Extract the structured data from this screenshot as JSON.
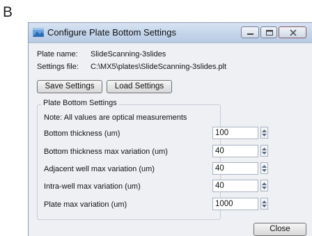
{
  "panel_letter": "B",
  "window": {
    "title": "Configure Plate Bottom Settings",
    "controls": {
      "minimize_icon": "minimize-icon",
      "maximize_icon": "maximize-icon",
      "close_icon": "close-x-icon"
    }
  },
  "info": {
    "plate_name_label": "Plate name:",
    "plate_name_value": "SlideScanning-3slides",
    "settings_file_label": "Settings file:",
    "settings_file_value": "C:\\MX5\\plates\\SlideScanning-3slides.plt"
  },
  "buttons": {
    "save": "Save Settings",
    "load": "Load Settings",
    "close": "Close"
  },
  "group": {
    "title": "Plate Bottom Settings",
    "note": "Note: All values are optical measurements",
    "fields": [
      {
        "label": "Bottom thickness (um)",
        "value": "100"
      },
      {
        "label": "Bottom thickness max variation (um)",
        "value": "40"
      },
      {
        "label": "Adjacent well max variation (um)",
        "value": "40"
      },
      {
        "label": "Intra-well max variation (um)",
        "value": "40"
      },
      {
        "label": "Plate max variation (um)",
        "value": "1000"
      }
    ]
  },
  "colors": {
    "titlebar": "#c3d4ea",
    "window_bg": "#eef0f4",
    "accent": "#3c7fc9"
  }
}
